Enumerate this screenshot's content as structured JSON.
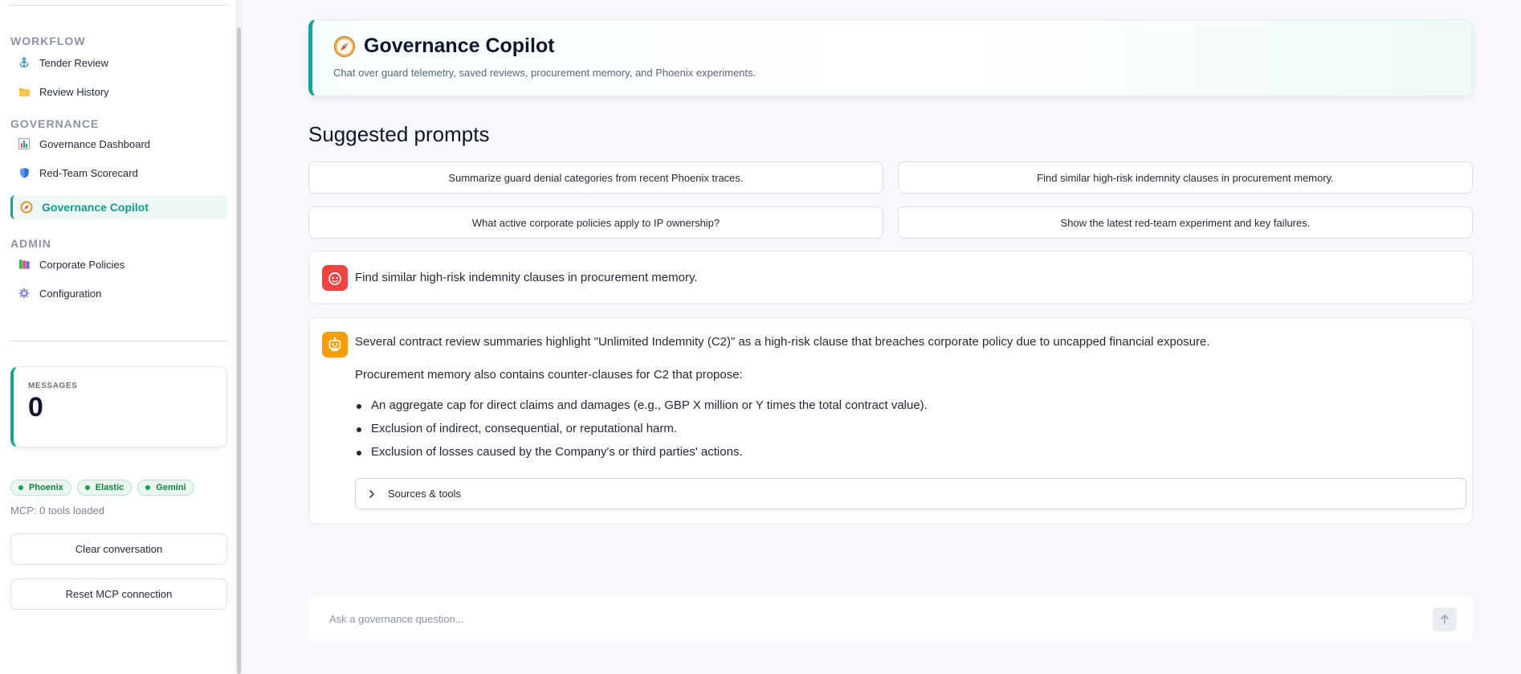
{
  "sidebar": {
    "sections": {
      "workflow": "WORKFLOW",
      "governance": "GOVERNANCE",
      "admin": "ADMIN"
    },
    "items": {
      "tender_review": "Tender Review",
      "review_history": "Review History",
      "governance_dashboard": "Governance Dashboard",
      "red_team_scorecard": "Red-Team Scorecard",
      "governance_copilot": "Governance Copilot",
      "corporate_policies": "Corporate Policies",
      "configuration": "Configuration"
    },
    "icons": {
      "tender_review": "anchor-icon",
      "review_history": "folder-icon",
      "governance_dashboard": "bar-chart-icon",
      "red_team_scorecard": "shield-icon",
      "governance_copilot": "compass-icon",
      "corporate_policies": "books-icon",
      "configuration": "gear-icon"
    },
    "metric": {
      "label": "MESSAGES",
      "value": "0"
    },
    "badges": {
      "phoenix": "Phoenix",
      "elastic": "Elastic",
      "gemini": "Gemini"
    },
    "mcp_status": "MCP: 0 tools loaded",
    "clear_button": "Clear conversation",
    "reset_button": "Reset MCP connection"
  },
  "header": {
    "title": "Governance Copilot",
    "subtitle": "Chat over guard telemetry, saved reviews, procurement memory, and Phoenix experiments."
  },
  "suggested": {
    "title": "Suggested prompts",
    "prompts": [
      "Summarize guard denial categories from recent Phoenix traces.",
      "Find similar high-risk indemnity clauses in procurement memory.",
      "What active corporate policies apply to IP ownership?",
      "Show the latest red-team experiment and key failures."
    ]
  },
  "conversation": {
    "user_message": "Find similar high-risk indemnity clauses in procurement memory.",
    "assistant": {
      "paragraph1": "Several contract review summaries highlight \"Unlimited Indemnity (C2)\" as a high-risk clause that breaches corporate policy due to uncapped financial exposure.",
      "paragraph2": "Procurement memory also contains counter-clauses for C2 that propose:",
      "bullets": [
        "An aggregate cap for direct claims and damages (e.g., GBP X million or Y times the total contract value).",
        "Exclusion of indirect, consequential, or reputational harm.",
        "Exclusion of losses caused by the Company's or third parties' actions."
      ],
      "sources_label": "Sources & tools"
    }
  },
  "chat_input": {
    "placeholder": "Ask a governance question..."
  },
  "colors": {
    "accent": "#16a394",
    "user_avatar": "#ef4444",
    "bot_avatar": "#f59e0b",
    "badge_green": "#16a34a"
  }
}
